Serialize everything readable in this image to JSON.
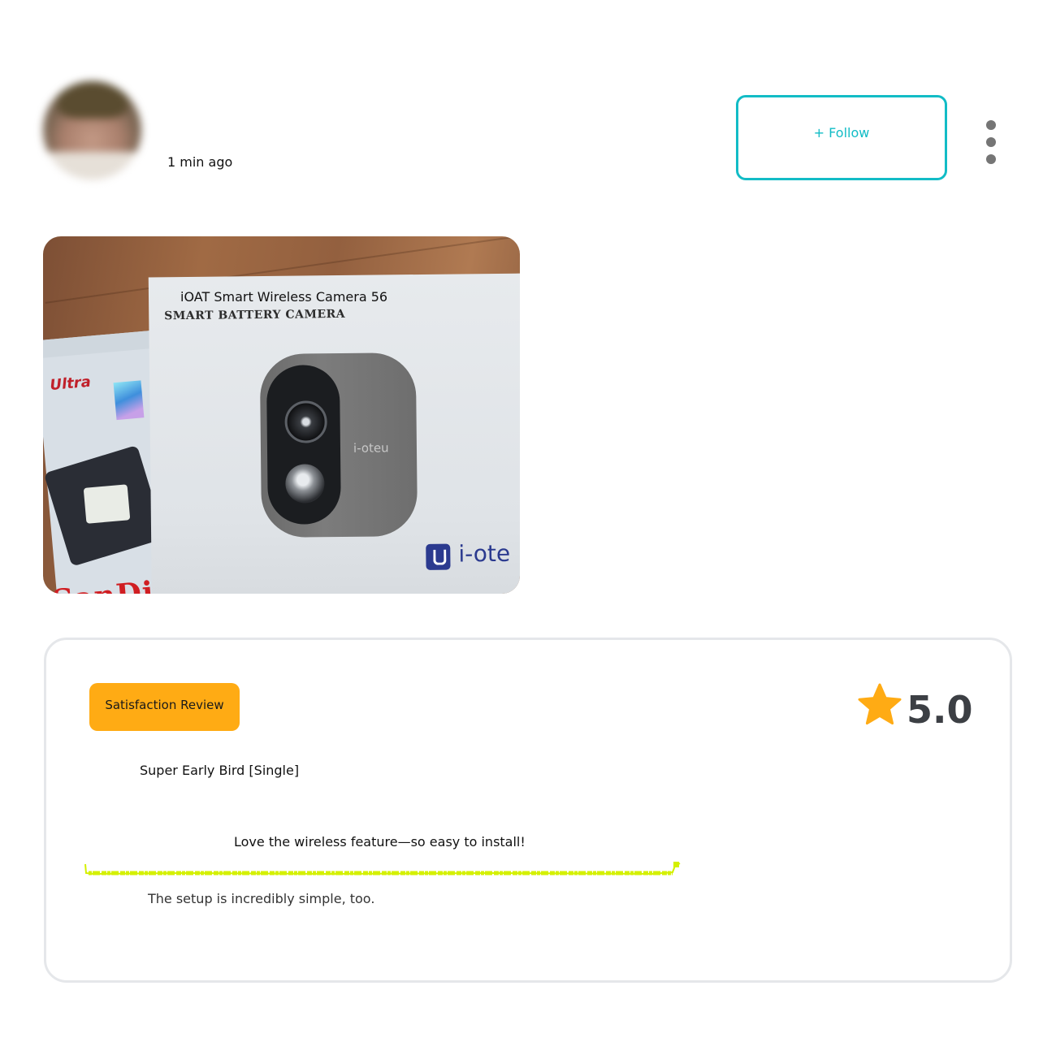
{
  "post": {
    "timestamp": "1 min ago",
    "follow_label": "+ Follow",
    "more_icon": "more-vertical-icon"
  },
  "product": {
    "title": "iOAT Smart Wireless Camera 56",
    "photo_texts": {
      "box_subtitle": "SMART BATTERY CAMERA",
      "camera_logo": "i-oteu",
      "brand": "i-ote",
      "card_label": "Ultra",
      "card_brand": "SanDisk"
    }
  },
  "review": {
    "badge": "Satisfaction Review",
    "rating": "5.0",
    "rating_icon": "star-icon",
    "option": "Super Early Bird [Single]",
    "headline": "Love the wireless feature—so easy to install!",
    "body": "The setup is incredibly simple, too."
  },
  "colors": {
    "accent": "#12bcc6",
    "badge_bg": "#ffab14",
    "star": "#ffab14",
    "highlight": "#d4f000",
    "rating_text": "#3c3f44",
    "card_border": "#e5e7ea"
  }
}
